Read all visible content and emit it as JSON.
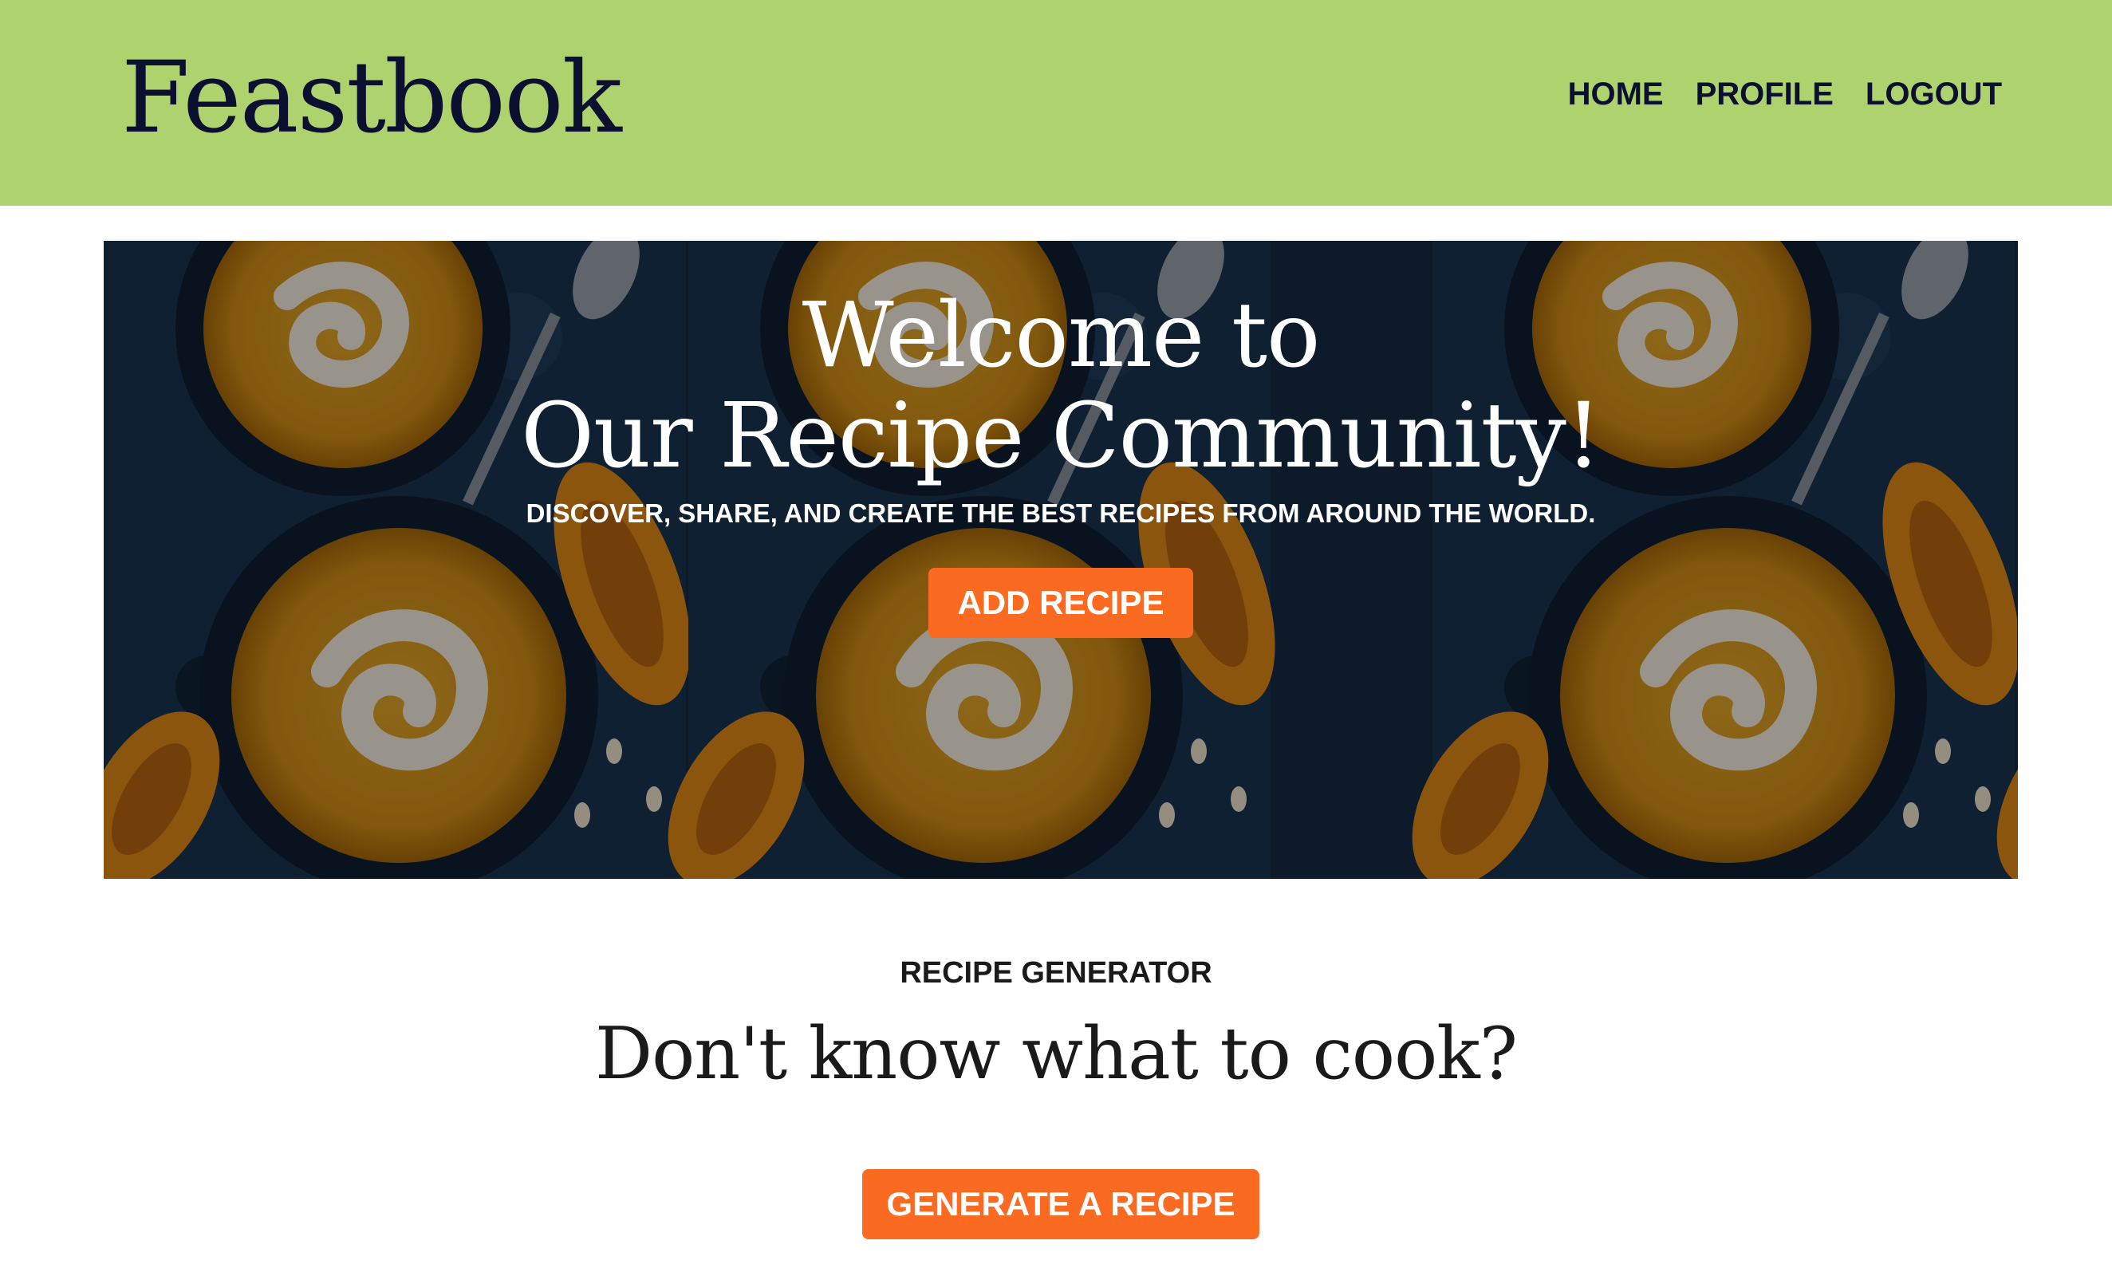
{
  "header": {
    "logo": "Feastbook",
    "nav": [
      "HOME",
      "PROFILE",
      "LOGOUT"
    ]
  },
  "hero": {
    "title_line1": "Welcome to",
    "title_line2": "Our Recipe Community!",
    "subtitle": "DISCOVER, SHARE, AND CREATE THE BEST RECIPES FROM AROUND THE WORLD.",
    "button": "ADD RECIPE",
    "image": "pumpkin-soup-bowls-photo"
  },
  "generator": {
    "label": "RECIPE GENERATOR",
    "title": "Don't know what to cook?",
    "button": "GENERATE A RECIPE"
  },
  "colors": {
    "header_bg": "#aed36e",
    "accent": "#fb6a21",
    "text_dark": "#0b1030"
  }
}
